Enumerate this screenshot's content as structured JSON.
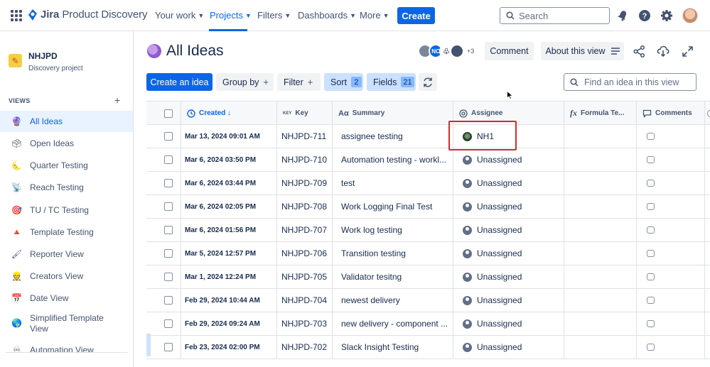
{
  "app": {
    "logo_bold": "Jira",
    "logo_light": " Product Discovery"
  },
  "topnav": {
    "items": [
      {
        "label": "Your work"
      },
      {
        "label": "Projects"
      },
      {
        "label": "Filters"
      },
      {
        "label": "Dashboards"
      },
      {
        "label": "More"
      }
    ],
    "create_label": "Create",
    "search_placeholder": "Search",
    "icons": [
      "notification-icon",
      "help-icon",
      "settings-icon",
      "profile-avatar"
    ]
  },
  "sidebar": {
    "project_name": "NHJPD",
    "project_sub": "Discovery project",
    "views_label": "VIEWS",
    "items": [
      {
        "label": "All Ideas",
        "icon": "🔮"
      },
      {
        "label": "Open Ideas",
        "icon": "🗳"
      },
      {
        "label": "Quarter Testing",
        "icon": "🌜"
      },
      {
        "label": "Reach Testing",
        "icon": "📡"
      },
      {
        "label": "TU / TC Testing",
        "icon": "🎯"
      },
      {
        "label": "Template Testing",
        "icon": "🔺"
      },
      {
        "label": "Reporter View",
        "icon": "🖌"
      },
      {
        "label": "Creators View",
        "icon": "👷"
      },
      {
        "label": "Date View",
        "icon": "📅"
      },
      {
        "label": "Simplified Template View",
        "icon": "🌎"
      },
      {
        "label": "Automation View",
        "icon": "♾"
      }
    ]
  },
  "header": {
    "title": "All Ideas",
    "avatar_initials": "NC",
    "more_count": "+3",
    "comment_label": "Comment",
    "about_label": "About this view"
  },
  "toolbar": {
    "create_idea": "Create an idea",
    "group_by": "Group by",
    "filter": "Filter",
    "sort": "Sort",
    "sort_count": "2",
    "fields": "Fields",
    "fields_count": "21",
    "find_placeholder": "Find an idea in this view"
  },
  "table": {
    "columns": {
      "created": "Created ↓",
      "key_prefix": "KEY",
      "key": "Key",
      "summary": "Summary",
      "assignee": "Assignee",
      "formula": "Formula Te...",
      "comments": "Comments"
    },
    "rows": [
      {
        "created": "Mar 13, 2024 09:01 AM",
        "key": "NHJPD-711",
        "summary": "assignee testing",
        "assignee": "NH1"
      },
      {
        "created": "Mar 6, 2024 03:50 PM",
        "key": "NHJPD-710",
        "summary": "Automation testing - workl...",
        "assignee": "Unassigned"
      },
      {
        "created": "Mar 6, 2024 03:44 PM",
        "key": "NHJPD-709",
        "summary": "test",
        "assignee": "Unassigned"
      },
      {
        "created": "Mar 6, 2024 02:05 PM",
        "key": "NHJPD-708",
        "summary": "Work Logging Final Test",
        "assignee": "Unassigned"
      },
      {
        "created": "Mar 6, 2024 01:56 PM",
        "key": "NHJPD-707",
        "summary": "Work log testing",
        "assignee": "Unassigned"
      },
      {
        "created": "Mar 5, 2024 12:57 PM",
        "key": "NHJPD-706",
        "summary": "Transition testing",
        "assignee": "Unassigned"
      },
      {
        "created": "Mar 1, 2024 12:24 PM",
        "key": "NHJPD-705",
        "summary": "Validator tesitng",
        "assignee": "Unassigned"
      },
      {
        "created": "Feb 29, 2024 10:44 AM",
        "key": "NHJPD-704",
        "summary": "newest delivery",
        "assignee": "Unassigned"
      },
      {
        "created": "Feb 29, 2024 09:24 AM",
        "key": "NHJPD-703",
        "summary": "new delivery - component ...",
        "assignee": "Unassigned"
      },
      {
        "created": "Feb 23, 2024 02:00 PM",
        "key": "NHJPD-702",
        "summary": "Slack Insight Testing",
        "assignee": "Unassigned"
      }
    ]
  },
  "colors": {
    "accent": "#0c66e4",
    "highlight_box": "#c9302c"
  }
}
